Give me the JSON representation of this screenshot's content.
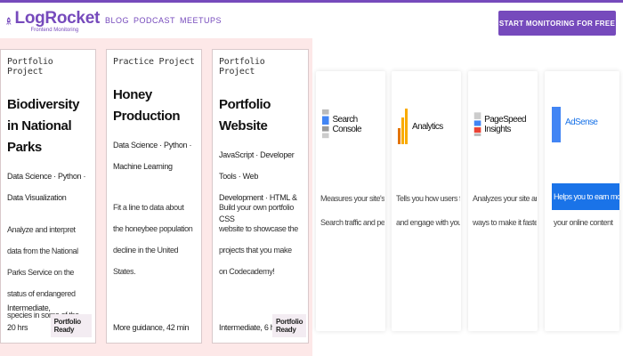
{
  "header": {
    "logo_name": "LogRocket",
    "logo_sub": "Frontend Monitoring",
    "nav": [
      "BLOG",
      "PODCAST",
      "MEETUPS"
    ],
    "cta": "START MONITORING FOR FREE"
  },
  "projects": [
    {
      "kind": "Portfolio Project",
      "title": "Biodiversity in National Parks",
      "tags": "Data Science · Python · Data Visualization",
      "description": "Analyze and interpret data from the National Parks Service on the status of endangered species in some of the…",
      "difficulty": "Intermediate, 20 hrs",
      "badge": "Portfolio Ready"
    },
    {
      "kind": "Practice Project",
      "title": "Honey Production",
      "tags": "Data Science · Python · Machine Learning",
      "description": "Fit a line to data about the honeybee population decline in the United States.",
      "difficulty": "More guidance, 42 min",
      "badge": ""
    },
    {
      "kind": "Portfolio Project",
      "title": "Portfolio Website",
      "tags": "JavaScript · Developer Tools · Web Development · HTML & CSS",
      "description": "Build your own portfolio website to showcase the projects that you make on Codecademy!",
      "difficulty": "Intermediate, 6 hrs",
      "badge": "Portfolio Ready"
    }
  ],
  "tools": [
    {
      "name": "Search Console",
      "desc": [
        "Measures your site's Google",
        "Search traffic and performance"
      ],
      "icon": "search-console-icon"
    },
    {
      "name": "Analytics",
      "desc": [
        "Tells you how users find, use,",
        "and engage with your site"
      ],
      "icon": "analytics-icon"
    },
    {
      "name": "PageSpeed Insights",
      "desc": [
        "Analyzes your site and suggests",
        "ways to make it faster"
      ],
      "icon": "pagespeed-icon"
    },
    {
      "name": "AdSense",
      "desc": [
        "Helps you to earn money from",
        "your online content"
      ],
      "icon": "adsense-icon"
    }
  ],
  "colors": {
    "brand": "#764abc",
    "pink_panel": "#fde8e8",
    "adsense_blue": "#1a73e8"
  }
}
